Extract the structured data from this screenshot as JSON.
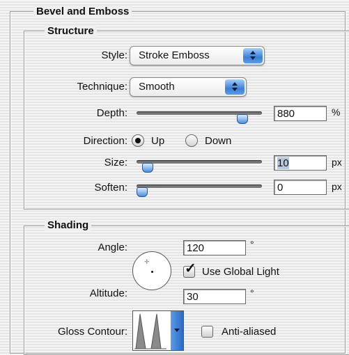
{
  "bevel_emboss": {
    "title": "Bevel and Emboss",
    "structure": {
      "legend": "Structure",
      "style_label": "Style:",
      "style_value": "Stroke Emboss",
      "technique_label": "Technique:",
      "technique_value": "Smooth",
      "depth_label": "Depth:",
      "depth_value": "880",
      "depth_unit": "%",
      "depth_slider_fraction": 0.87,
      "direction_label": "Direction:",
      "direction_up": "Up",
      "direction_down": "Down",
      "direction_selected": "Up",
      "size_label": "Size:",
      "size_value": "10",
      "size_unit": "px",
      "size_slider_fraction": 0.05,
      "soften_label": "Soften:",
      "soften_value": "0",
      "soften_unit": "px",
      "soften_slider_fraction": 0.0
    },
    "shading": {
      "legend": "Shading",
      "angle_label": "Angle:",
      "angle_value": "120",
      "angle_unit": "°",
      "use_global_light_label": "Use Global Light",
      "use_global_light_checked": true,
      "altitude_label": "Altitude:",
      "altitude_value": "30",
      "altitude_unit": "°",
      "gloss_contour_label": "Gloss Contour:",
      "anti_aliased_label": "Anti-aliased",
      "anti_aliased_checked": false
    }
  },
  "colors": {
    "accent": "#3b7fd6",
    "selection": "#b9c8dc"
  },
  "icons": {
    "popup_arrows": "updown-arrows-icon",
    "dropdown_arrow": "chevron-down-icon"
  }
}
